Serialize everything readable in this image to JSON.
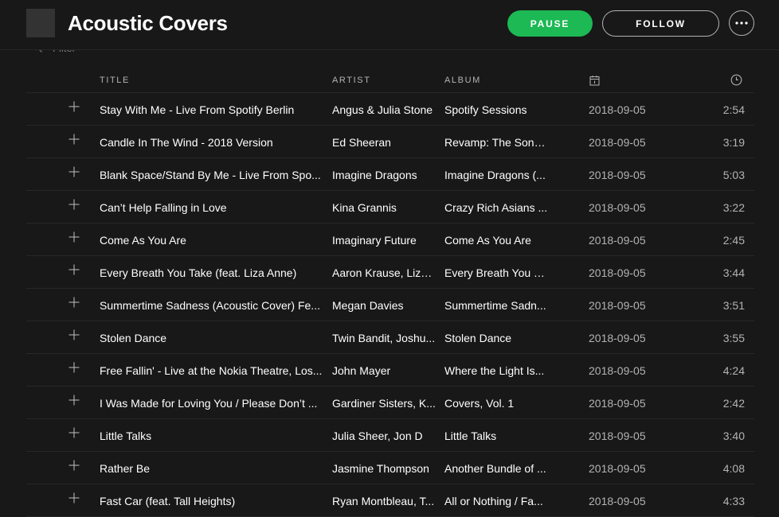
{
  "header": {
    "title": "Acoustic Covers",
    "pause_label": "PAUSE",
    "follow_label": "FOLLOW"
  },
  "filter": {
    "placeholder": "Filter"
  },
  "columns": {
    "title": "TITLE",
    "artist": "ARTIST",
    "album": "ALBUM"
  },
  "icons": {
    "more": "ellipsis-icon",
    "filter": "search-icon",
    "add": "plus-icon",
    "date": "calendar-icon",
    "duration": "clock-icon"
  },
  "colors": {
    "accent": "#1db954",
    "background": "#181818",
    "muted": "#b3b3b3"
  },
  "tracks": [
    {
      "title": "Stay With Me - Live From Spotify Berlin",
      "artist": "Angus & Julia Stone",
      "album": "Spotify Sessions",
      "date": "2018-09-05",
      "duration": "2:54"
    },
    {
      "title": "Candle In The Wind - 2018 Version",
      "artist": "Ed Sheeran",
      "album": "Revamp: The Song...",
      "date": "2018-09-05",
      "duration": "3:19"
    },
    {
      "title": "Blank Space/Stand By Me - Live From Spo...",
      "artist": "Imagine Dragons",
      "album": "Imagine Dragons (...",
      "date": "2018-09-05",
      "duration": "5:03"
    },
    {
      "title": "Can’t Help Falling in Love",
      "artist": "Kina Grannis",
      "album": "Crazy Rich Asians ...",
      "date": "2018-09-05",
      "duration": "3:22"
    },
    {
      "title": "Come As You Are",
      "artist": "Imaginary Future",
      "album": "Come As You Are",
      "date": "2018-09-05",
      "duration": "2:45"
    },
    {
      "title": "Every Breath You Take (feat. Liza Anne)",
      "artist": "Aaron Krause, Liza...",
      "album": "Every Breath You T...",
      "date": "2018-09-05",
      "duration": "3:44"
    },
    {
      "title": "Summertime Sadness (Acoustic Cover) Fe...",
      "artist": "Megan Davies",
      "album": "Summertime Sadn...",
      "date": "2018-09-05",
      "duration": "3:51"
    },
    {
      "title": "Stolen Dance",
      "artist": "Twin Bandit, Joshu...",
      "album": "Stolen Dance",
      "date": "2018-09-05",
      "duration": "3:55"
    },
    {
      "title": "Free Fallin' - Live at the Nokia Theatre, Los...",
      "artist": "John Mayer",
      "album": "Where the Light Is...",
      "date": "2018-09-05",
      "duration": "4:24"
    },
    {
      "title": "I Was Made for Loving You / Please Don’t ...",
      "artist": "Gardiner Sisters, K...",
      "album": "Covers, Vol. 1",
      "date": "2018-09-05",
      "duration": "2:42"
    },
    {
      "title": "Little Talks",
      "artist": "Julia Sheer, Jon D",
      "album": "Little Talks",
      "date": "2018-09-05",
      "duration": "3:40"
    },
    {
      "title": "Rather Be",
      "artist": "Jasmine Thompson",
      "album": "Another Bundle of ...",
      "date": "2018-09-05",
      "duration": "4:08"
    },
    {
      "title": "Fast Car (feat. Tall Heights)",
      "artist": "Ryan Montbleau, T...",
      "album": "All or Nothing / Fa...",
      "date": "2018-09-05",
      "duration": "4:33"
    }
  ]
}
